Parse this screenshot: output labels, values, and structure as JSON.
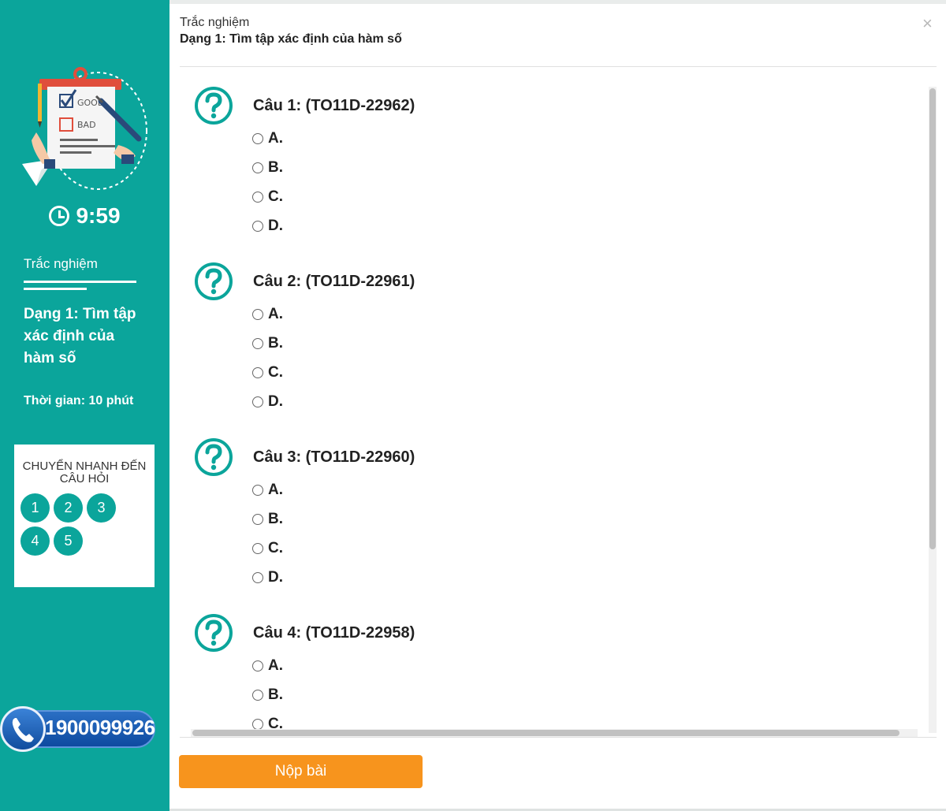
{
  "sidebar": {
    "timer": "9:59",
    "category": "Trắc nghiệm",
    "topic": "Dạng 1: Tìm tập xác định của hàm số",
    "time_limit": "Thời gian: 10 phút",
    "illustration_labels": {
      "good": "GOOD",
      "bad": "BAD"
    },
    "quicknav": {
      "title": "CHUYỂN NHANH ĐẾN CÂU HỎI",
      "buttons": [
        "1",
        "2",
        "3",
        "4",
        "5"
      ]
    },
    "hotline": "1900099926"
  },
  "header": {
    "category": "Trắc nghiệm",
    "topic": "Dạng 1: Tìm tập xác định của hàm số",
    "close": "×"
  },
  "questions": [
    {
      "title": "Câu 1: (TO11D-22962)",
      "options": [
        "A.",
        "B.",
        "C.",
        "D."
      ]
    },
    {
      "title": "Câu 2: (TO11D-22961)",
      "options": [
        "A.",
        "B.",
        "C.",
        "D."
      ]
    },
    {
      "title": "Câu 3: (TO11D-22960)",
      "options": [
        "A.",
        "B.",
        "C.",
        "D."
      ]
    },
    {
      "title": "Câu 4: (TO11D-22958)",
      "options": [
        "A.",
        "B.",
        "C."
      ]
    }
  ],
  "footer": {
    "submit_label": "Nộp bài"
  },
  "colors": {
    "teal": "#0ba59b",
    "orange": "#f7941d",
    "hotline_blue": "#1a5db5"
  }
}
